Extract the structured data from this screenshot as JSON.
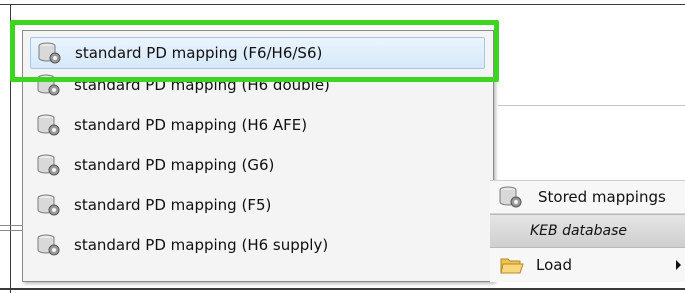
{
  "mapping_list": {
    "items": [
      {
        "label": "standard PD mapping (F6/H6/S6)",
        "selected": true
      },
      {
        "label": "standard PD mapping (H6 double)",
        "selected": false
      },
      {
        "label": "standard PD mapping (H6 AFE)",
        "selected": false
      },
      {
        "label": "standard PD mapping (G6)",
        "selected": false
      },
      {
        "label": "standard PD mapping (F5)",
        "selected": false
      },
      {
        "label": "standard PD mapping (H6 supply)",
        "selected": false
      }
    ]
  },
  "context_menu": {
    "stored_mappings_label": "Stored mappings",
    "keb_database_label": "KEB database",
    "load_label": "Load"
  },
  "colors": {
    "highlight": "#3ed520",
    "selection_border": "#a5c8ea",
    "selection_fill": "#d6e9fa",
    "menu_header": "#d9d9d9",
    "folder": "#f2c14e"
  },
  "icons": {
    "mapping_item": "database-gear-icon",
    "stored_mappings": "database-gear-icon",
    "load": "open-folder-icon",
    "submenu": "chevron-right-icon"
  }
}
